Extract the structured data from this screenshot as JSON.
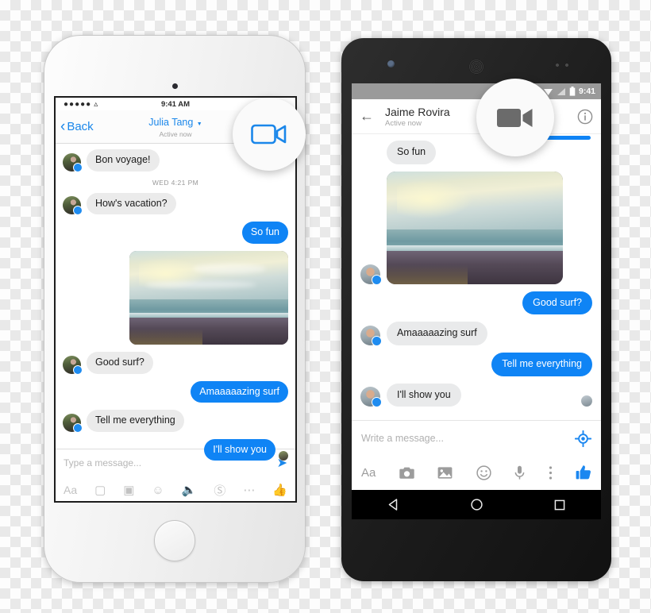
{
  "iphone": {
    "status": {
      "signal_dots": "●●●●●",
      "wifi_icon": "wifi-icon",
      "time": "9:41 AM"
    },
    "nav": {
      "back_label": "Back",
      "contact_name": "Julia Tang",
      "presence": "Active now",
      "caret_icon": "caret-down-icon"
    },
    "daystamp": "WED 4:21 PM",
    "messages": [
      {
        "text": "Bon voyage!",
        "dir": "in",
        "type": "text"
      },
      {
        "text": "How's vacation?",
        "dir": "in",
        "type": "text"
      },
      {
        "text": "So fun",
        "dir": "out",
        "type": "text"
      },
      {
        "text": "beach-sunset-photo",
        "dir": "out",
        "type": "photo"
      },
      {
        "text": "Good surf?",
        "dir": "in",
        "type": "text"
      },
      {
        "text": "Amaaaaazing surf",
        "dir": "out",
        "type": "text"
      },
      {
        "text": "Tell me everything",
        "dir": "in",
        "type": "text"
      },
      {
        "text": "I'll show you",
        "dir": "out",
        "type": "text"
      }
    ],
    "input": {
      "placeholder": "Type a message...",
      "send_icon": "send-arrow-icon",
      "icons": [
        "Aa",
        "camera-icon",
        "gallery-icon",
        "emoji-icon",
        "mic-icon",
        "dollar-icon",
        "more-dots-icon",
        "thumbs-up-icon"
      ]
    },
    "callout_icon": "video-camera-icon"
  },
  "android": {
    "status": {
      "wifi_icon": "wifi-icon",
      "signal_icon": "signal-icon",
      "battery_icon": "battery-icon",
      "time": "9:41"
    },
    "appbar": {
      "back_icon": "back-arrow-icon",
      "contact_name": "Jaime Rovira",
      "presence": "Active now",
      "info_icon": "info-icon"
    },
    "messages": [
      {
        "text": "So fun",
        "dir": "in",
        "type": "text"
      },
      {
        "text": "beach-sunset-photo",
        "dir": "in",
        "type": "photo"
      },
      {
        "text": "Good surf?",
        "dir": "out",
        "type": "text"
      },
      {
        "text": "Amaaaaazing surf",
        "dir": "in",
        "type": "text"
      },
      {
        "text": "Tell me everything",
        "dir": "out",
        "type": "text"
      },
      {
        "text": "I'll show you",
        "dir": "in",
        "type": "text"
      }
    ],
    "input": {
      "placeholder": "Write a message...",
      "location_icon": "location-icon",
      "icons": [
        "Aa",
        "camera-icon",
        "gallery-icon",
        "emoji-icon",
        "mic-icon",
        "kebab-menu-icon",
        "thumbs-up-icon"
      ]
    },
    "navbar": [
      "back-triangle-icon",
      "home-circle-icon",
      "recents-square-icon"
    ],
    "callout_icon": "video-camera-icon"
  },
  "colors": {
    "accent_blue": "#0f84f5",
    "ios_blue": "#1b87ea",
    "bubble_gray": "#ebebeb",
    "status_gray": "#9a9a9a"
  }
}
